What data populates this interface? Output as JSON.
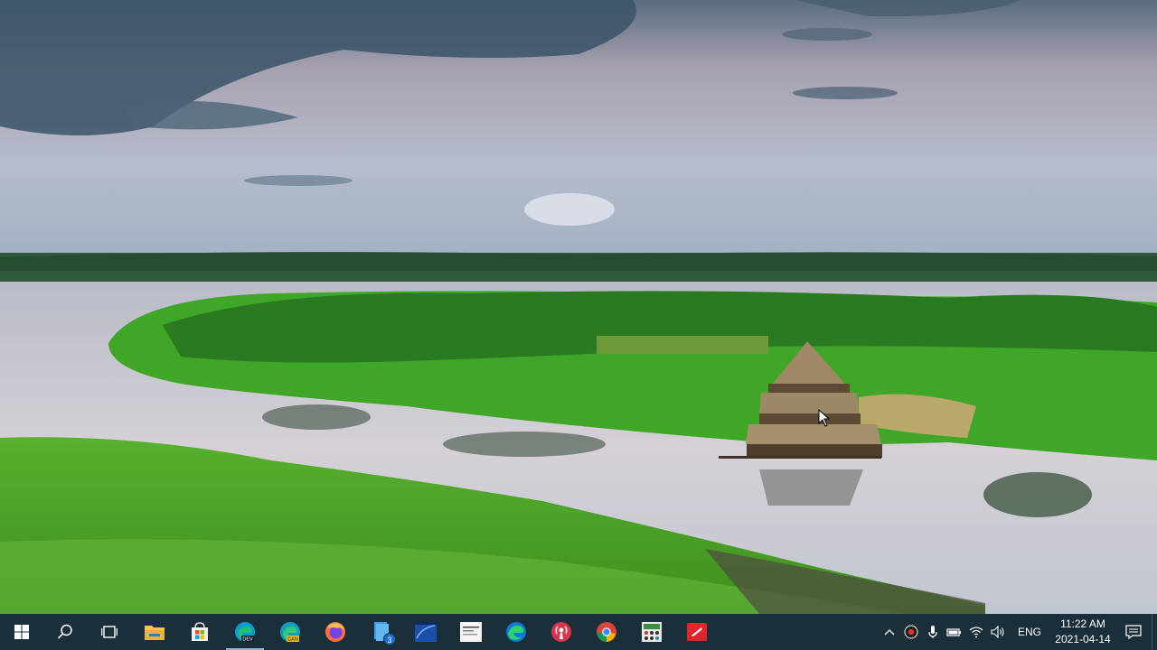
{
  "desktop": {
    "wallpaper": "landscape-lake-thatched-hut",
    "colors": {
      "sky_top": "#3f5a6e",
      "sky_mid": "#a9a6b5",
      "water": "#c9cdd6",
      "grass": "#4fb52a",
      "taskbar": "#1b2f3a"
    }
  },
  "taskbar": {
    "start_icon": "windows-logo-icon",
    "search_icon": "search-icon",
    "taskview_icon": "task-view-icon",
    "pinned": [
      {
        "name": "file-explorer",
        "icon": "folder-icon",
        "active": false
      },
      {
        "name": "microsoft-store",
        "icon": "store-icon",
        "active": false
      },
      {
        "name": "edge-dev",
        "icon": "edge-dev-icon",
        "active": true
      },
      {
        "name": "edge-canary",
        "icon": "edge-canary-icon",
        "active": false
      },
      {
        "name": "firefox",
        "icon": "firefox-icon",
        "active": false
      },
      {
        "name": "files-3",
        "icon": "files-icon",
        "active": false,
        "badge": "3"
      },
      {
        "name": "terminal-app",
        "icon": "window-app-icon",
        "active": false
      },
      {
        "name": "web-app",
        "icon": "document-app-icon",
        "active": false
      },
      {
        "name": "edge",
        "icon": "edge-icon",
        "active": false
      },
      {
        "name": "podcast-app",
        "icon": "podcast-icon",
        "active": false
      },
      {
        "name": "chrome",
        "icon": "chrome-icon",
        "active": false
      },
      {
        "name": "calculator-app",
        "icon": "calculator-icon",
        "active": false
      },
      {
        "name": "red-app",
        "icon": "red-tile-icon",
        "active": false
      }
    ]
  },
  "tray": {
    "icons": [
      "chevron-up-icon",
      "recording-icon",
      "microphone-icon",
      "battery-icon",
      "wifi-icon",
      "volume-icon"
    ],
    "language": "ENG",
    "time": "11:22 AM",
    "date": "2021-04-14",
    "notification_icon": "notification-icon"
  }
}
